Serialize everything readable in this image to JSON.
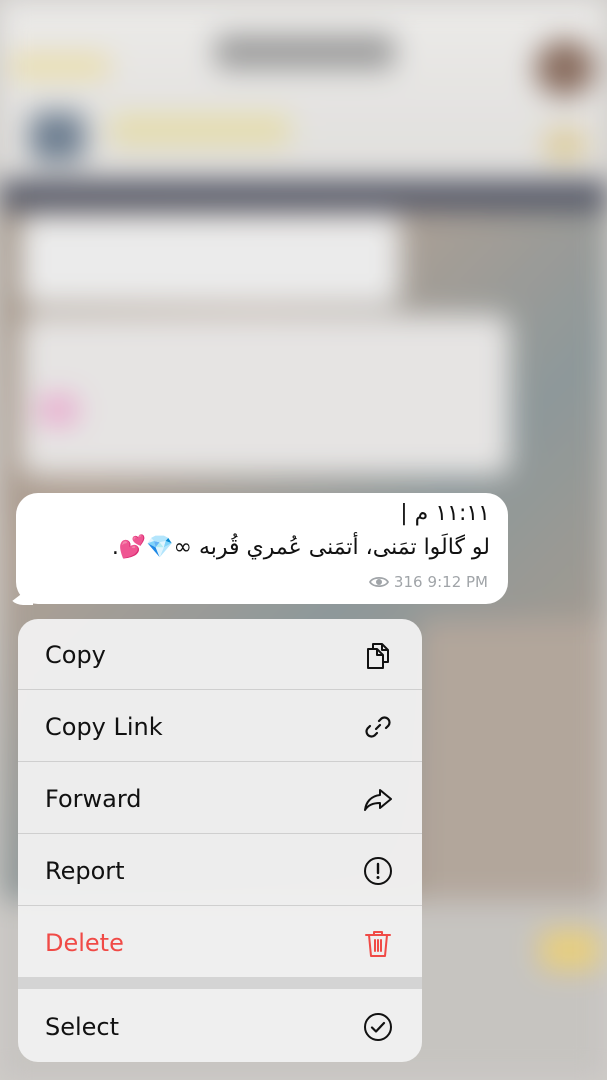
{
  "message": {
    "header": "١١:١١ م |",
    "text": "لو گالَوا تمَنى، أتمَنى عُمري قُربه ∞💎💕.",
    "views": "316",
    "time": "9:12 PM"
  },
  "menu": {
    "items": [
      {
        "label": "Copy",
        "icon": "copy-icon"
      },
      {
        "label": "Copy Link",
        "icon": "link-icon"
      },
      {
        "label": "Forward",
        "icon": "forward-icon"
      },
      {
        "label": "Report",
        "icon": "report-icon"
      },
      {
        "label": "Delete",
        "icon": "trash-icon",
        "color": "#f04a46"
      },
      {
        "label": "Select",
        "icon": "checkmark-circle-icon"
      }
    ]
  },
  "colors": {
    "danger": "#f04a46",
    "meta_text": "#a0a4a8"
  }
}
